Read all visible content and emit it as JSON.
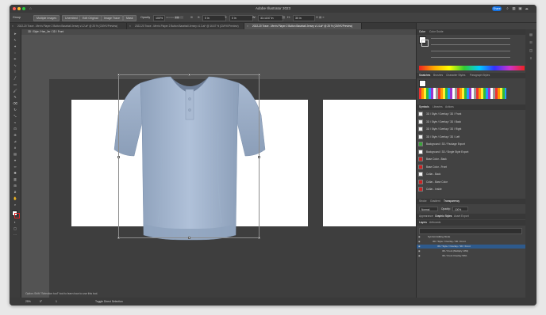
{
  "window": {
    "title": "Adobe Illustrator 2023",
    "share_label": "Share"
  },
  "control_bar": {
    "group_label": "Group",
    "multiple_images": "Multiple Images",
    "unembed": "Unembed",
    "edit_original": "Edit Original",
    "image_trace": "Image Trace",
    "mask": "Mask",
    "opacity_label": "Opacity",
    "opacity_value": "100%",
    "x_label": "X:",
    "x_value": "0 in",
    "y_label": "Y:",
    "y_value": "0 in",
    "w_label": "W:",
    "w_value": "33.1157 in",
    "h_label": "H:",
    "h_value": "30 in"
  },
  "tabs": [
    {
      "label": "2022-20 Trace - Men's Player 2 Button Baseball Jersey v1.2.ai* @ 25 % (CMYK/Preview)"
    },
    {
      "label": "2022-20 Trace - Men's Player 2 Button Baseball Jersey v1.3.ai* @ 16.67 % (CMYK/Preview)"
    },
    {
      "label": "2022-20 Trace - Men's Player 2 Button Baseball Jersey v1.4.ai* @ 25 % (CMYK/Preview)"
    }
  ],
  "breadcrumb": "3D / Style / Hse_Jer / 3D / Front",
  "right_panel": {
    "color_tabs": [
      "Color",
      "Color Guide"
    ],
    "swatch_tabs": [
      "Swatches",
      "Brushes",
      "Character Styles",
      "Paragraph Styles"
    ],
    "symbol_tabs": [
      "Symbols",
      "Libraries",
      "Actions"
    ],
    "symbols": [
      {
        "label": "3D / Style / Overlay / 3D / Front",
        "color": "#f2f2f2"
      },
      {
        "label": "3D / Style / Overlay / 3D / Back",
        "color": "#f2f2f2"
      },
      {
        "label": "3D / Style / Overlay / 3D / Right",
        "color": "#f2f2f2"
      },
      {
        "label": "3D / Style / Overlay / 3D / Left",
        "color": "#f2f2f2"
      },
      {
        "label": "Background / 3D / Package Export",
        "color": "#3aa53a"
      },
      {
        "label": "Background / 3D / Single Style Export",
        "color": "#ffffff"
      },
      {
        "label": "Base Color - Back",
        "color": "#cc2222"
      },
      {
        "label": "Base Color - Front",
        "color": "#cc2222"
      },
      {
        "label": "Collar - Back",
        "color": "#f2f2f2"
      },
      {
        "label": "Collar - Base Color",
        "color": "#cc2222"
      },
      {
        "label": "Collar - Inside",
        "color": "#cc2222"
      }
    ],
    "transparency_tabs": [
      "Stroke",
      "Gradient",
      "Transparency"
    ],
    "blend_mode": "Normal",
    "opacity_label": "Opacity:",
    "opacity_value": "100%",
    "appearance_tabs": [
      "Appearance",
      "Graphic Styles",
      "Asset Export"
    ],
    "layers_tabs": [
      "Layers",
      "Artboards"
    ],
    "layers": [
      {
        "label": "Symbol Editing Mode",
        "indent": 0
      },
      {
        "label": "3D / Style / Overlay / 3D / Front",
        "indent": 1
      },
      {
        "label": "3D / Style / Overlay / 3D / Front",
        "indent": 2
      },
      {
        "label": "3D / Front (Multiply 10%)",
        "indent": 3
      },
      {
        "label": "3D / Front Overlay 50%",
        "indent": 3
      }
    ]
  },
  "status": {
    "zoom": "25%",
    "angle": "0°",
    "page": "1",
    "tool_label": "Toggle Direct Selection",
    "hint": "Option-Shift-\"Selection tool\" tool to learn how to use this tool."
  }
}
